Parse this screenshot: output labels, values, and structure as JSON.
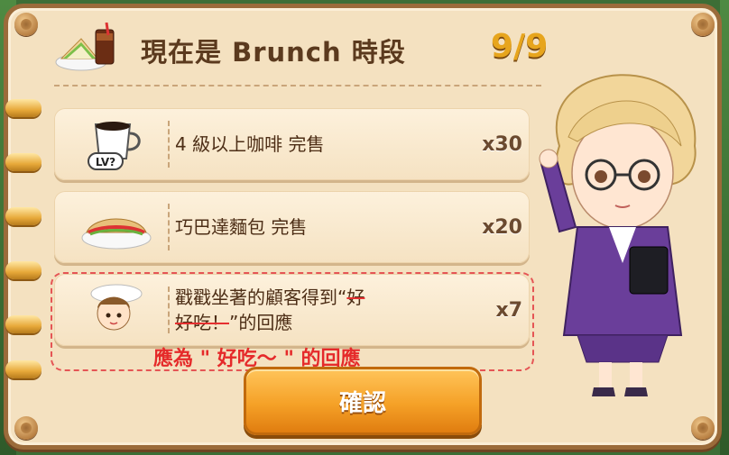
{
  "header": {
    "title": "現在是 Brunch 時段",
    "count": "9/9",
    "icon": "sandwich-coffee-icon"
  },
  "items": [
    {
      "icon": "coffee-cup-level-icon",
      "icon_badge": "LV?",
      "label": "4 級以上咖啡 完售",
      "qty": "x30"
    },
    {
      "icon": "panini-sandwich-icon",
      "label": "巧巴達麵包 完售",
      "qty": "x20"
    },
    {
      "icon": "customer-portrait-icon",
      "label_line1": "戳戳坐著的顧客得到“",
      "label_struck_a": "好",
      "label_struck_b": "好吃！",
      "label_line2_rest": "”的回應",
      "qty": "x7"
    }
  ],
  "annotation": {
    "correction": "應為 \" 好吃～ \" 的回應",
    "color": "#e52a2a"
  },
  "confirm_button": {
    "label": "確認"
  },
  "character": {
    "icon": "businesswoman-character"
  },
  "colors": {
    "panel": "#f4e1c0",
    "frame": "#9b6b3a",
    "accent": "#e7a51d",
    "button": "#f5a127"
  }
}
